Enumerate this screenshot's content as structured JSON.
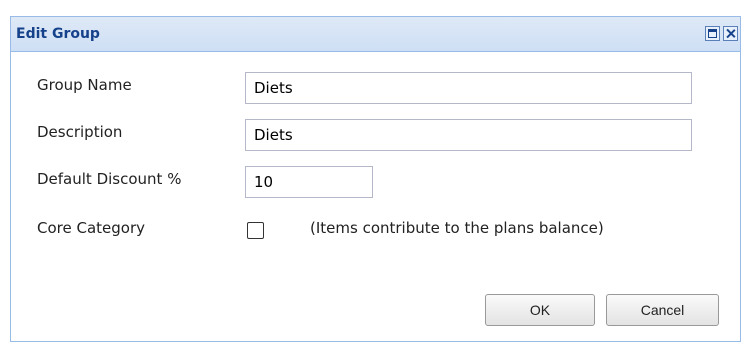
{
  "window": {
    "title": "Edit Group"
  },
  "form": {
    "group_name": {
      "label": "Group Name",
      "value": "Diets"
    },
    "description": {
      "label": "Description",
      "value": "Diets"
    },
    "default_discount": {
      "label": "Default Discount %",
      "value": "10"
    },
    "core_category": {
      "label": "Core Category",
      "checked": false,
      "note": "(Items contribute to the plans balance)"
    }
  },
  "buttons": {
    "ok_label": "OK",
    "cancel_label": "Cancel"
  },
  "colors": {
    "title_text": "#15428b",
    "header_bg": "#dfe9f6",
    "border": "#99bbe8"
  },
  "icons": [
    "maximize-icon",
    "close-icon"
  ]
}
